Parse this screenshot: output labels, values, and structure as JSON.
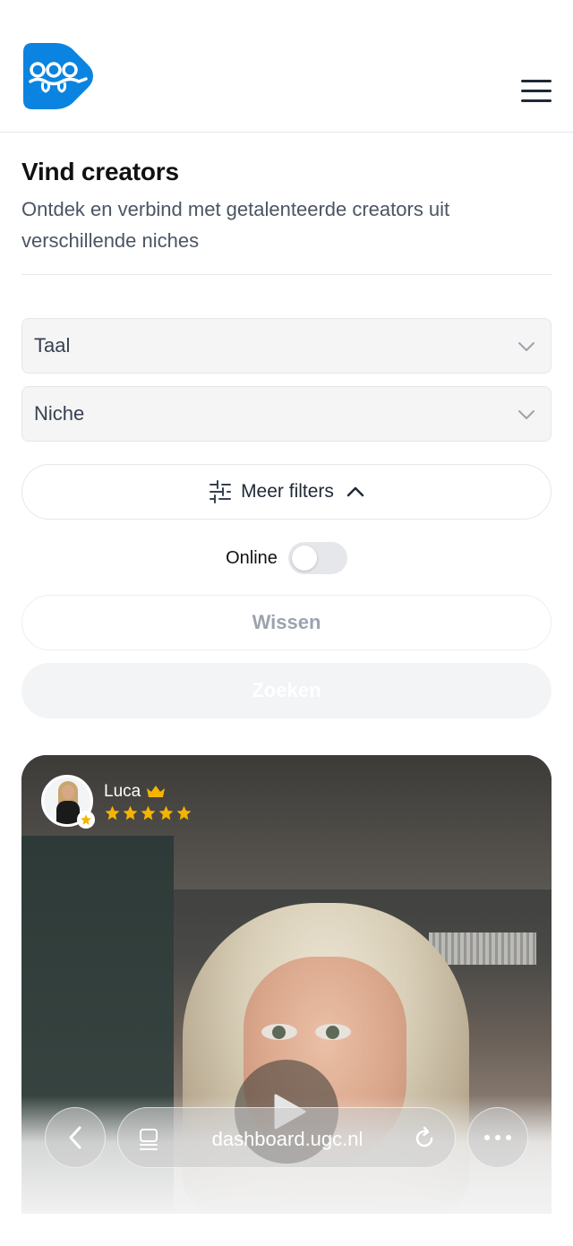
{
  "header": {
    "logo_icon": "ugc-logo-icon",
    "menu_icon": "hamburger-menu-icon"
  },
  "main": {
    "title": "Vind creators",
    "subtitle": "Ontdek en verbind met getalenteerde creators uit verschillende niches"
  },
  "filters": {
    "language_placeholder": "Taal",
    "niche_placeholder": "Niche",
    "more_filters_label": "Meer filters",
    "online_label": "Online",
    "online_enabled": false,
    "clear_label": "Wissen",
    "search_label": "Zoeken"
  },
  "creator_card": {
    "name": "Luca",
    "rating": 5,
    "badge": "crown-icon"
  },
  "browser": {
    "url": "dashboard.ugc.nl"
  },
  "colors": {
    "brand": "#0a84e0",
    "star": "#f5b400",
    "text_primary": "#111111",
    "text_secondary": "#4b5563"
  }
}
